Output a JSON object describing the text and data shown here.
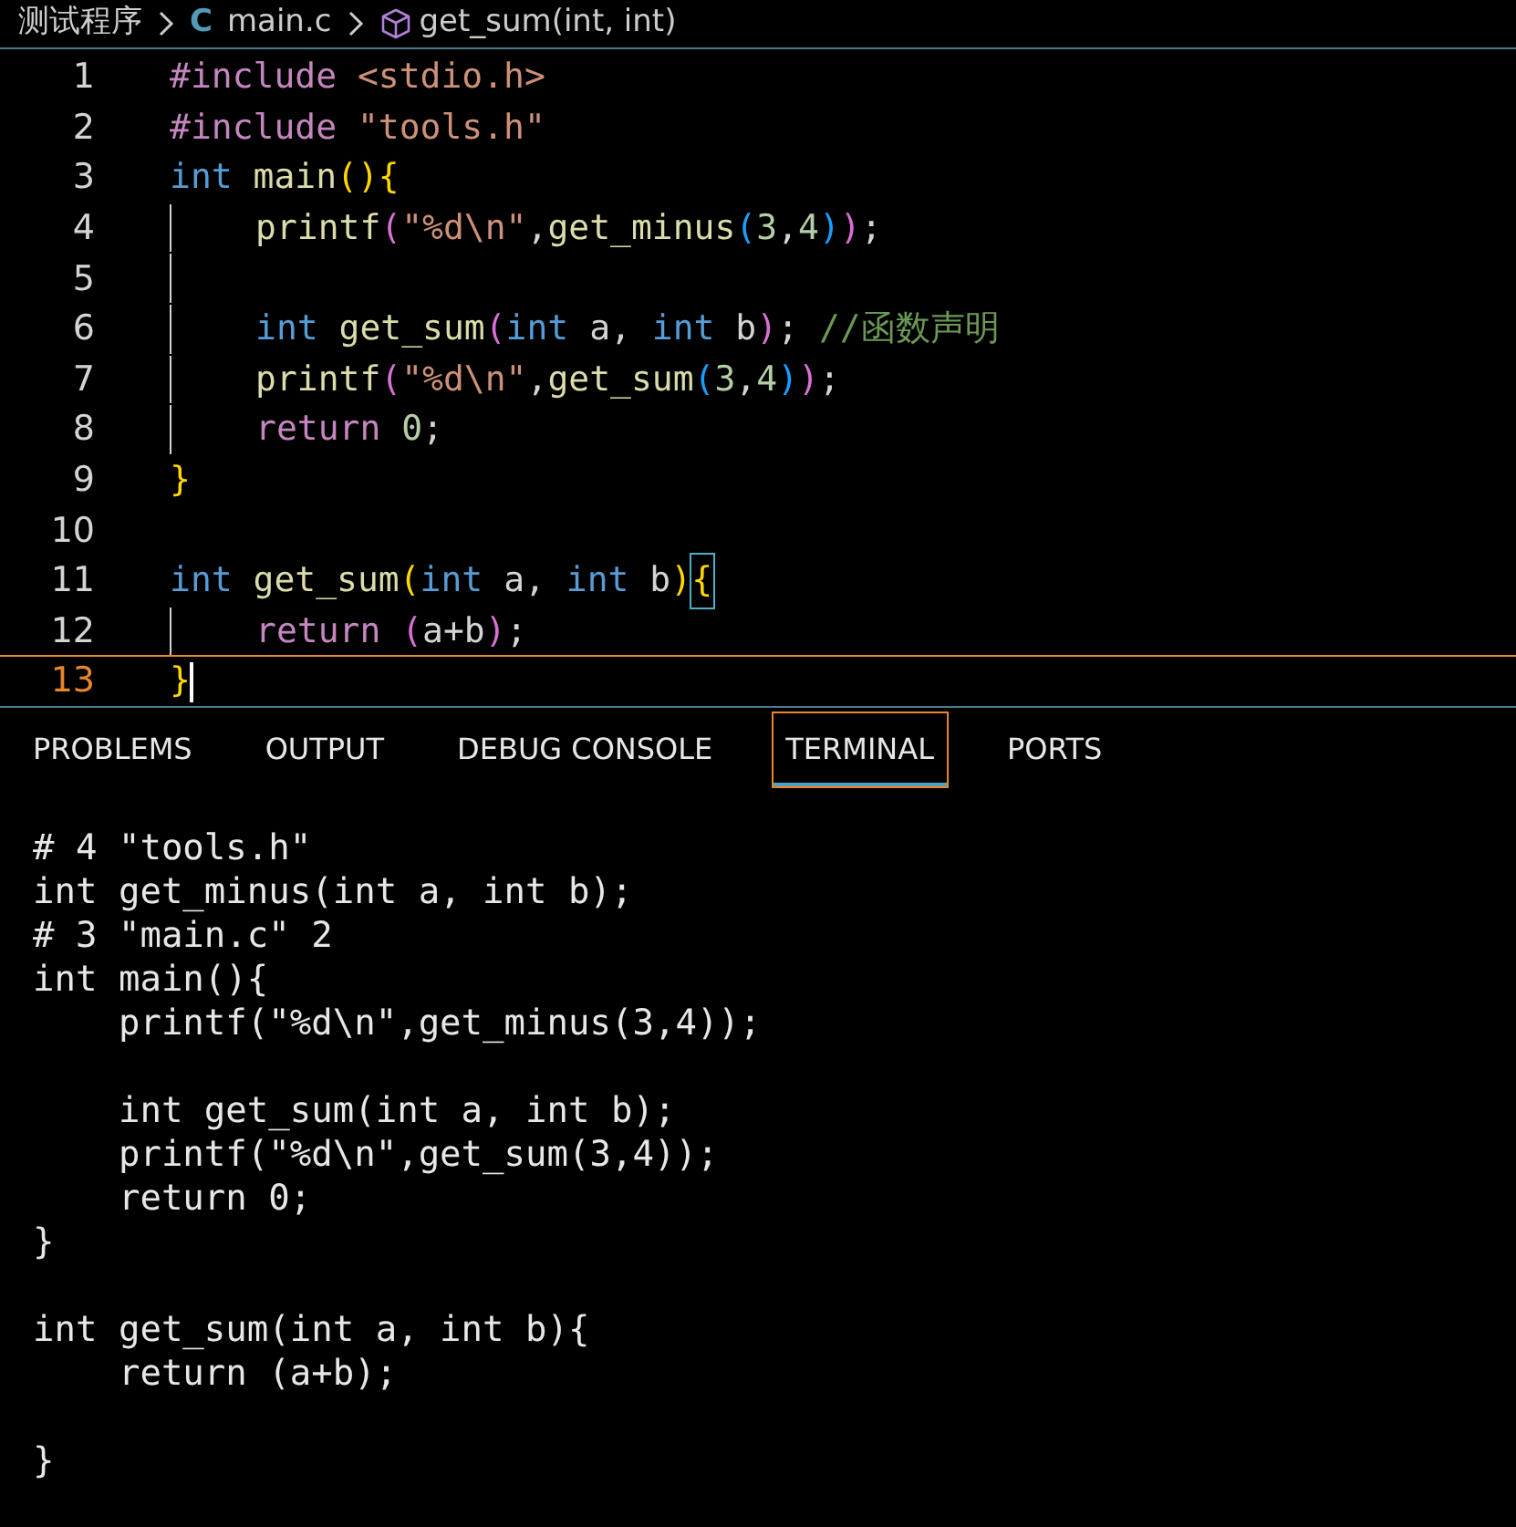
{
  "breadcrumb": {
    "folder": "测试程序",
    "file_icon": "C",
    "file": "main.c",
    "symbol": "get_sum(int, int)"
  },
  "editor": {
    "lines": [
      {
        "number": "1",
        "current": false,
        "indent": false,
        "tokens": [
          {
            "kind": "pre",
            "text": "#include"
          },
          {
            "kind": "str",
            "text": " <stdio.h>"
          }
        ]
      },
      {
        "number": "2",
        "current": false,
        "indent": false,
        "tokens": [
          {
            "kind": "pre",
            "text": "#include"
          },
          {
            "kind": "str",
            "text": " \"tools.h\""
          }
        ]
      },
      {
        "number": "3",
        "current": false,
        "indent": false,
        "tokens": [
          {
            "kind": "kw",
            "text": "int"
          },
          {
            "kind": "fn",
            "text": " main"
          },
          {
            "kind": "p1",
            "text": "()"
          },
          {
            "kind": "p1",
            "text": "{"
          }
        ]
      },
      {
        "number": "4",
        "current": false,
        "indent": true,
        "tokens": [
          {
            "kind": "fn",
            "text": "printf"
          },
          {
            "kind": "p2",
            "text": "("
          },
          {
            "kind": "str",
            "text": "\"%d\\n\""
          },
          {
            "kind": "plain",
            "text": ","
          },
          {
            "kind": "fn",
            "text": "get_minus"
          },
          {
            "kind": "p3",
            "text": "("
          },
          {
            "kind": "num",
            "text": "3"
          },
          {
            "kind": "plain",
            "text": ","
          },
          {
            "kind": "num",
            "text": "4"
          },
          {
            "kind": "p3",
            "text": ")"
          },
          {
            "kind": "p2",
            "text": ")"
          },
          {
            "kind": "plain",
            "text": ";"
          }
        ]
      },
      {
        "number": "5",
        "current": false,
        "indent": true
      },
      {
        "number": "6",
        "current": false,
        "indent": true,
        "tokens": [
          {
            "kind": "kw",
            "text": "int"
          },
          {
            "kind": "fn",
            "text": " get_sum"
          },
          {
            "kind": "p2",
            "text": "("
          },
          {
            "kind": "kw",
            "text": "int"
          },
          {
            "kind": "plain",
            "text": " a, "
          },
          {
            "kind": "kw",
            "text": "int"
          },
          {
            "kind": "plain",
            "text": " b"
          },
          {
            "kind": "p2",
            "text": ")"
          },
          {
            "kind": "plain",
            "text": ";"
          },
          {
            "kind": "comment",
            "text": " //函数声明"
          }
        ]
      },
      {
        "number": "7",
        "current": false,
        "indent": true,
        "tokens": [
          {
            "kind": "fn",
            "text": "printf"
          },
          {
            "kind": "p2",
            "text": "("
          },
          {
            "kind": "str",
            "text": "\"%d\\n\""
          },
          {
            "kind": "plain",
            "text": ","
          },
          {
            "kind": "fn",
            "text": "get_sum"
          },
          {
            "kind": "p3",
            "text": "("
          },
          {
            "kind": "num",
            "text": "3"
          },
          {
            "kind": "plain",
            "text": ","
          },
          {
            "kind": "num",
            "text": "4"
          },
          {
            "kind": "p3",
            "text": ")"
          },
          {
            "kind": "p2",
            "text": ")"
          },
          {
            "kind": "plain",
            "text": ";"
          }
        ]
      },
      {
        "number": "8",
        "current": false,
        "indent": true,
        "tokens": [
          {
            "kind": "ctl",
            "text": "return"
          },
          {
            "kind": "num",
            "text": " 0"
          },
          {
            "kind": "plain",
            "text": ";"
          }
        ]
      },
      {
        "number": "9",
        "current": false,
        "indent": false,
        "tokens": [
          {
            "kind": "p1",
            "text": "}"
          }
        ]
      },
      {
        "number": "10",
        "current": false,
        "indent": false
      },
      {
        "number": "11",
        "current": false,
        "indent": false,
        "tokens": [
          {
            "kind": "kw",
            "text": "int"
          },
          {
            "kind": "fn",
            "text": " get_sum"
          },
          {
            "kind": "p1",
            "text": "("
          },
          {
            "kind": "kw",
            "text": "int"
          },
          {
            "kind": "plain",
            "text": " a, "
          },
          {
            "kind": "kw",
            "text": "int"
          },
          {
            "kind": "plain",
            "text": " b"
          },
          {
            "kind": "p1",
            "text": ")"
          },
          {
            "kind": "match",
            "text": "{"
          }
        ]
      },
      {
        "number": "12",
        "current": false,
        "indent": true,
        "tokens": [
          {
            "kind": "ctl",
            "text": "return"
          },
          {
            "kind": "p2",
            "text": " ("
          },
          {
            "kind": "plain",
            "text": "a+b"
          },
          {
            "kind": "p2",
            "text": ")"
          },
          {
            "kind": "plain",
            "text": ";"
          }
        ]
      },
      {
        "number": "13",
        "current": true,
        "indent": false,
        "tokens": [
          {
            "kind": "p1",
            "text": "}"
          }
        ]
      }
    ]
  },
  "panel_tabs": [
    {
      "label": "PROBLEMS",
      "selected": false
    },
    {
      "label": "OUTPUT",
      "selected": false
    },
    {
      "label": "DEBUG CONSOLE",
      "selected": false
    },
    {
      "label": "TERMINAL",
      "selected": true
    },
    {
      "label": "PORTS",
      "selected": false
    }
  ],
  "terminal": {
    "blocks": [
      [
        "# 4 \"tools.h\"",
        "int get_minus(int a, int b);",
        "# 3 \"main.c\" 2",
        "int main(){",
        "    printf(\"%d\\n\",get_minus(3,4));"
      ],
      [
        "    int get_sum(int a, int b);",
        "    printf(\"%d\\n\",get_sum(3,4));",
        "    return 0;",
        "}"
      ],
      [
        "int get_sum(int a, int b){",
        "    return (a+b);"
      ],
      [
        "}"
      ]
    ]
  }
}
